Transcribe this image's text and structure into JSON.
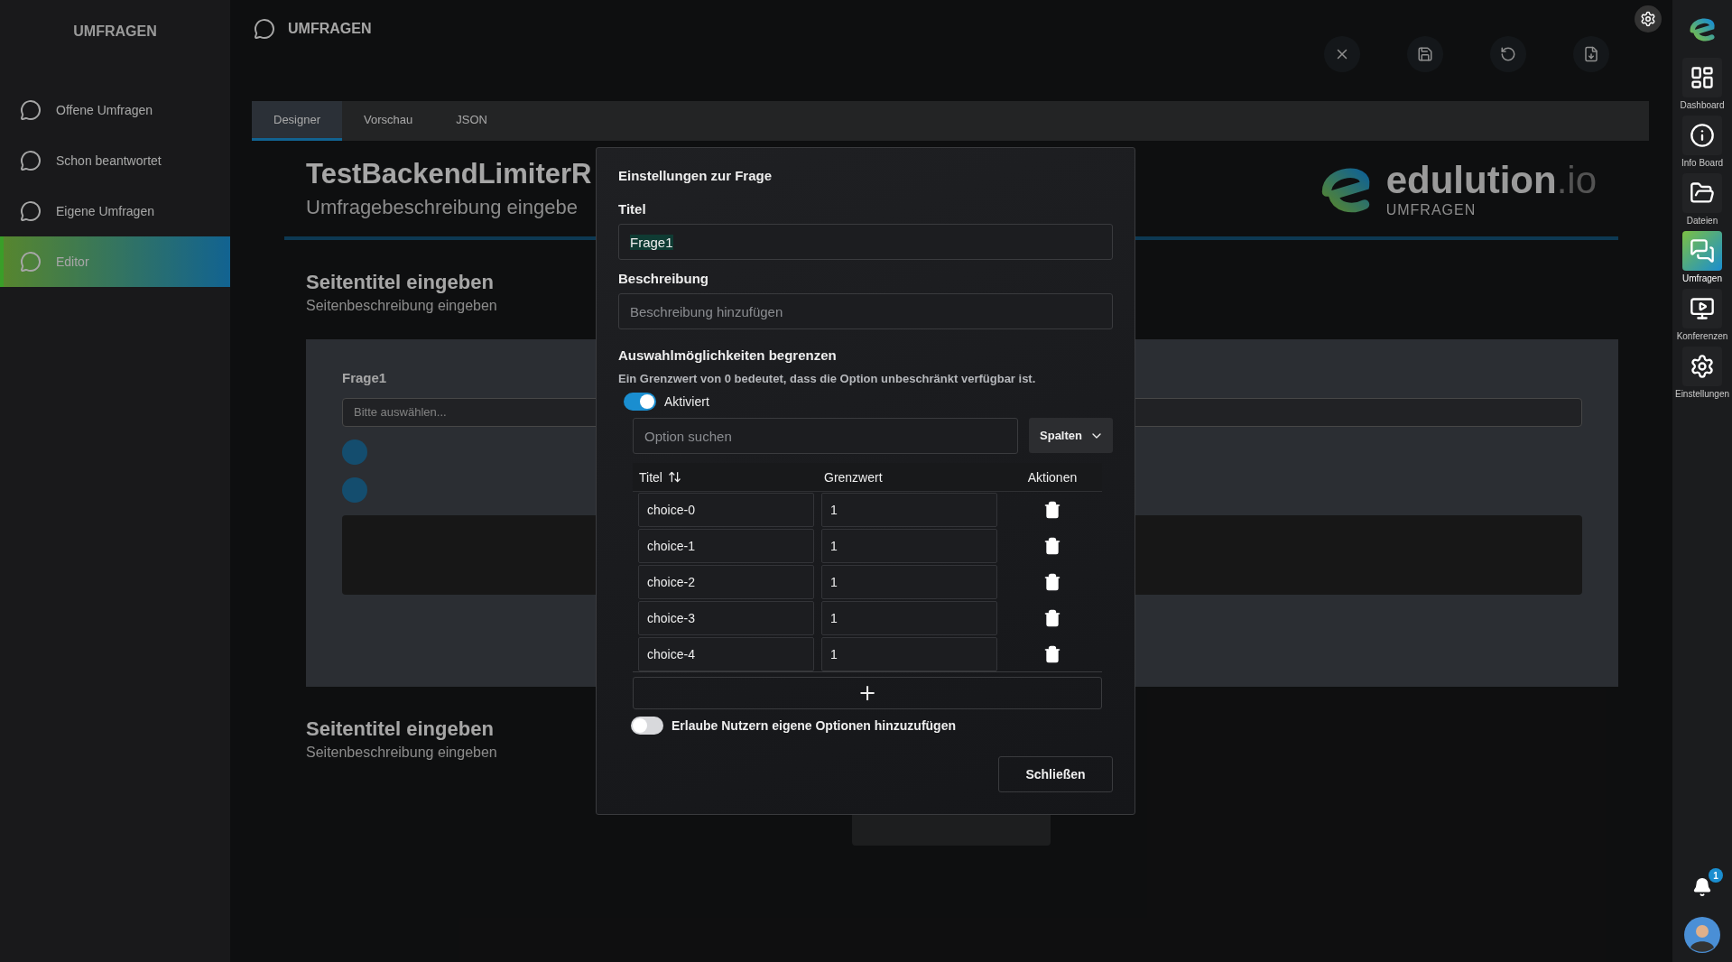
{
  "left_sidebar": {
    "title": "UMFRAGEN",
    "items": [
      {
        "label": "Offene Umfragen",
        "selected": false
      },
      {
        "label": "Schon beantwortet",
        "selected": false
      },
      {
        "label": "Eigene Umfragen",
        "selected": false
      },
      {
        "label": "Editor",
        "selected": true
      }
    ]
  },
  "header": {
    "title": "UMFRAGEN"
  },
  "tabs": [
    {
      "label": "Designer",
      "selected": true
    },
    {
      "label": "Vorschau",
      "selected": false
    },
    {
      "label": "JSON",
      "selected": false
    }
  ],
  "survey": {
    "title": "TestBackendLimiterR",
    "description": "Umfragebeschreibung eingebe",
    "logo": {
      "name": "edulution",
      "suffix": ".io",
      "subtitle": "UMFRAGEN"
    },
    "pages": [
      {
        "title": "Seitentitel eingeben",
        "description": "Seitenbeschreibung eingeben",
        "question": "Frage1",
        "select_placeholder": "Bitte auswählen..."
      },
      {
        "title": "Seitentitel eingeben",
        "description": "Seitenbeschreibung eingeben"
      }
    ]
  },
  "dialog": {
    "title": "Einstellungen zur Frage",
    "title_label": "Titel",
    "title_value": "Frage1",
    "description_label": "Beschreibung",
    "description_placeholder": "Beschreibung hinzufügen",
    "limit_heading": "Auswahlmöglichkeiten begrenzen",
    "limit_info": "Ein Grenzwert von 0 bedeutet, dass die Option unbeschränkt verfügbar ist.",
    "limit_toggle": {
      "label": "Aktiviert",
      "on": true
    },
    "search_placeholder": "Option suchen",
    "columns_button": "Spalten",
    "columns": [
      "Titel",
      "Grenzwert",
      "Aktionen"
    ],
    "rows": [
      {
        "title": "choice-0",
        "limit": "1"
      },
      {
        "title": "choice-1",
        "limit": "1"
      },
      {
        "title": "choice-2",
        "limit": "1"
      },
      {
        "title": "choice-3",
        "limit": "1"
      },
      {
        "title": "choice-4",
        "limit": "1"
      }
    ],
    "add_button": "+",
    "custom_toggle": {
      "label": "Erlaube Nutzern eigene Optionen hinzuzufügen",
      "on": false
    },
    "close_button": "Schließen"
  },
  "app_bar": {
    "items": [
      {
        "kind": "dashboard",
        "label": "Dashboard",
        "selected": false
      },
      {
        "kind": "info",
        "label": "Info Board",
        "selected": false
      },
      {
        "kind": "files",
        "label": "Dateien",
        "selected": false
      },
      {
        "kind": "surveys",
        "label": "Umfragen",
        "selected": true
      },
      {
        "kind": "conference",
        "label": "Konferenzen",
        "selected": false
      },
      {
        "kind": "settings",
        "label": "Einstellungen",
        "selected": false
      }
    ],
    "notifications": "1"
  }
}
